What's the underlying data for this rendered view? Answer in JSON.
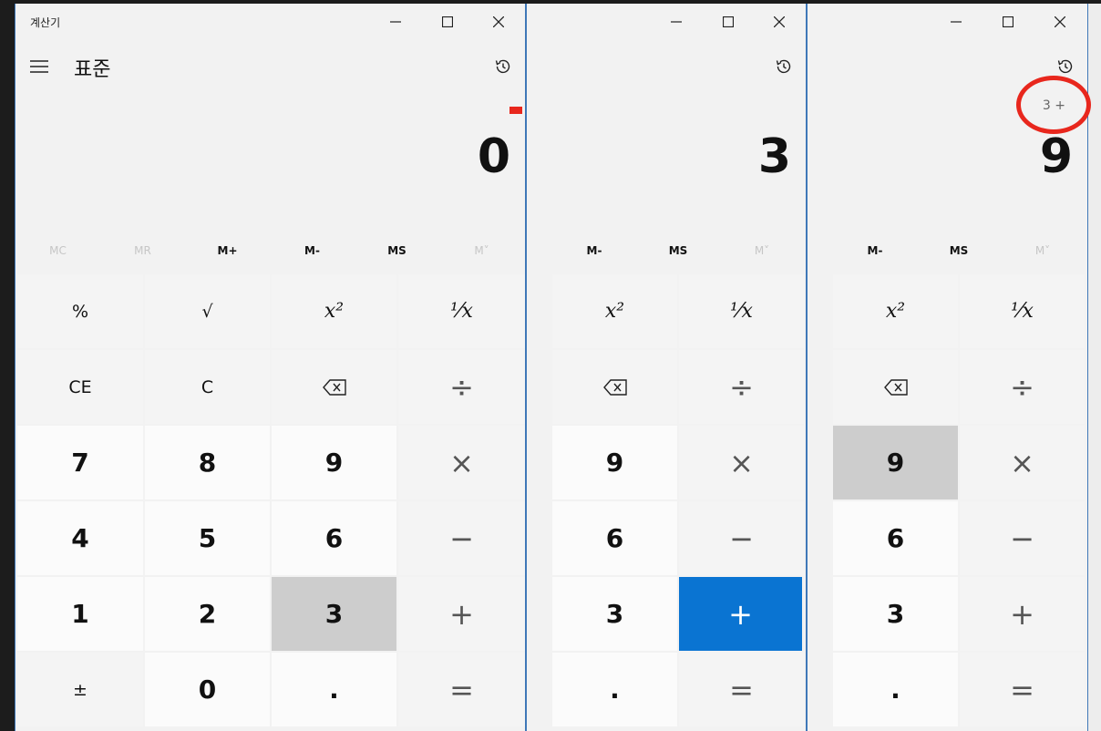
{
  "windows": [
    {
      "app_title": "계산기",
      "mode_title": "표준",
      "expression": "",
      "display": "0",
      "memory": [
        {
          "label": "MC",
          "enabled": false
        },
        {
          "label": "MR",
          "enabled": false
        },
        {
          "label": "M+",
          "enabled": true
        },
        {
          "label": "M-",
          "enabled": true
        },
        {
          "label": "MS",
          "enabled": true
        },
        {
          "label": "M˅",
          "enabled": false
        }
      ],
      "keys": [
        [
          "%",
          "√",
          "x²",
          "⅟x"
        ],
        [
          "CE",
          "C",
          "⌫",
          "÷"
        ],
        [
          "7",
          "8",
          "9",
          "×"
        ],
        [
          "4",
          "5",
          "6",
          "−"
        ],
        [
          "1",
          "2",
          "3",
          "+"
        ],
        [
          "±",
          "0",
          ".",
          "="
        ]
      ],
      "highlighted_key": "3"
    },
    {
      "display": "3",
      "memory": [
        {
          "label": "M-",
          "enabled": true
        },
        {
          "label": "MS",
          "enabled": true
        },
        {
          "label": "M˅",
          "enabled": false
        }
      ],
      "keys": [
        [
          "x²",
          "⅟x"
        ],
        [
          "⌫",
          "÷"
        ],
        [
          "9",
          "×"
        ],
        [
          "6",
          "−"
        ],
        [
          "3",
          "+"
        ],
        [
          ".",
          "="
        ]
      ],
      "highlighted_key": "+"
    },
    {
      "expression": "3 +",
      "display": "9",
      "memory": [
        {
          "label": "M-",
          "enabled": true
        },
        {
          "label": "MS",
          "enabled": true
        },
        {
          "label": "M˅",
          "enabled": false
        }
      ],
      "keys": [
        [
          "x²",
          "⅟x"
        ],
        [
          "⌫",
          "÷"
        ],
        [
          "9",
          "×"
        ],
        [
          "6",
          "−"
        ],
        [
          "3",
          "+"
        ],
        [
          ".",
          "="
        ]
      ],
      "highlighted_key": "9"
    }
  ],
  "colors": {
    "accent": "#0a74d2",
    "annotation": "#e8271d",
    "window_bg": "#f2f2f2"
  },
  "icons": [
    "minimize-icon",
    "maximize-icon",
    "close-icon",
    "hamburger-menu-icon",
    "history-icon",
    "backspace-icon"
  ]
}
